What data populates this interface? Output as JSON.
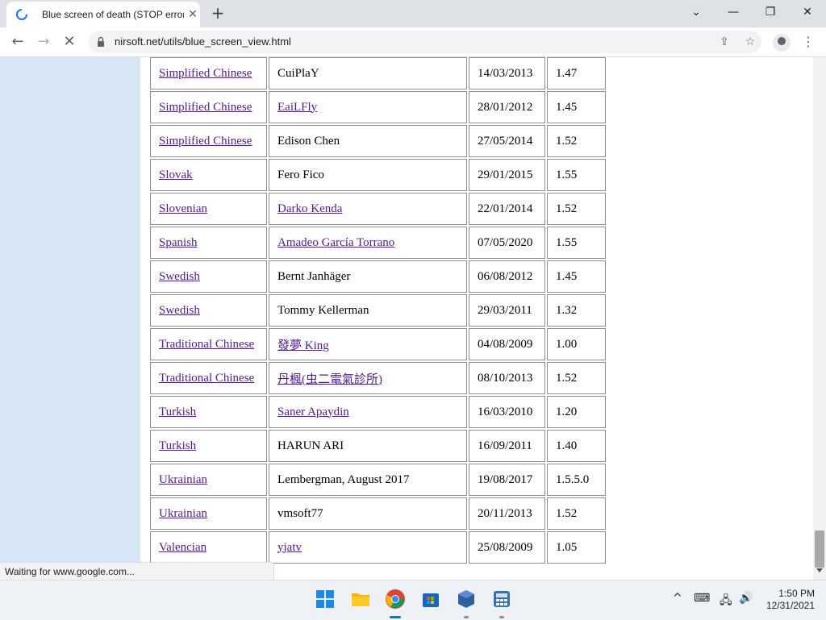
{
  "browser": {
    "tab": {
      "title": "Blue screen of death (STOP error",
      "close_label": "✕"
    },
    "new_tab_label": "+",
    "window": {
      "dropdown": "⌄",
      "minimize": "—",
      "restore": "❐",
      "close": "✕"
    },
    "nav": {
      "back": "←",
      "forward": "→",
      "reload_stop": "✕"
    },
    "url": "nirsoft.net/utils/blue_screen_view.html",
    "icons": [
      "share-icon",
      "star-icon",
      "profile-icon",
      "menu-icon"
    ],
    "status_text": "Waiting for www.google.com..."
  },
  "table": {
    "rows": [
      {
        "language": "",
        "translator": "",
        "date": "",
        "version": ""
      },
      {
        "language": "Simplified Chinese",
        "translator": "CuiPlaY",
        "translator_link": false,
        "date": "14/03/2013",
        "version": "1.47"
      },
      {
        "language": "Simplified Chinese",
        "translator": "EaiLFly",
        "translator_link": true,
        "date": "28/01/2012",
        "version": "1.45"
      },
      {
        "language": "Simplified Chinese",
        "translator": "Edison Chen",
        "translator_link": false,
        "date": "27/05/2014",
        "version": "1.52"
      },
      {
        "language": "Slovak",
        "translator": "Fero Fico",
        "translator_link": false,
        "date": "29/01/2015",
        "version": "1.55"
      },
      {
        "language": "Slovenian",
        "translator": "Darko Kenda",
        "translator_link": true,
        "date": "22/01/2014",
        "version": "1.52"
      },
      {
        "language": "Spanish",
        "translator": "Amadeo García Torrano",
        "translator_link": true,
        "date": "07/05/2020",
        "version": "1.55"
      },
      {
        "language": "Swedish",
        "translator": "Bernt Janhäger",
        "translator_link": false,
        "date": "06/08/2012",
        "version": "1.45"
      },
      {
        "language": "Swedish",
        "translator": "Tommy Kellerman",
        "translator_link": false,
        "date": "29/03/2011",
        "version": "1.32"
      },
      {
        "language": "Traditional Chinese",
        "translator": "發夢 King",
        "translator_link": true,
        "date": "04/08/2009",
        "version": "1.00"
      },
      {
        "language": "Traditional Chinese",
        "translator": "丹楓(虫二電氣診所)",
        "translator_link": true,
        "date": "08/10/2013",
        "version": "1.52"
      },
      {
        "language": "Turkish",
        "translator": "Saner Apaydin",
        "translator_link": true,
        "date": "16/03/2010",
        "version": "1.20"
      },
      {
        "language": "Turkish",
        "translator": "HARUN ARI",
        "translator_link": false,
        "date": "16/09/2011",
        "version": "1.40"
      },
      {
        "language": "Ukrainian",
        "translator": "Lembergman, August 2017",
        "translator_link": false,
        "date": "19/08/2017",
        "version": "1.5.5.0"
      },
      {
        "language": "Ukrainian",
        "translator": "vmsoft77",
        "translator_link": false,
        "date": "20/11/2013",
        "version": "1.52"
      },
      {
        "language": "Valencian",
        "translator": "yjatv",
        "translator_link": true,
        "date": "25/08/2009",
        "version": "1.05"
      }
    ]
  },
  "taskbar": {
    "apps": [
      "windows-start-icon",
      "file-explorer-icon",
      "chrome-icon",
      "microsoft-store-icon",
      "virtualbox-icon",
      "calculator-app-icon"
    ],
    "tray": {
      "chevron": "^",
      "keyboard": "⌨",
      "network": "🖧",
      "volume": "🔊"
    },
    "time": "1:50 PM",
    "date": "12/31/2021"
  },
  "colors": {
    "link": "#551a8b",
    "sidebar": "#d7e6f7",
    "tab_strip": "#dee1e6",
    "accent": "#1a73b8"
  }
}
